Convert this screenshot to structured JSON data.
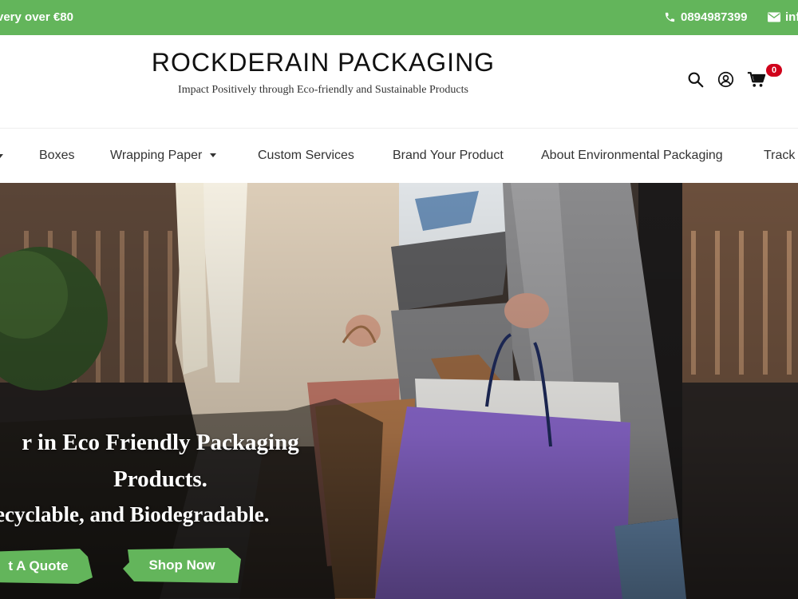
{
  "topbar": {
    "promo": "very over €80",
    "phone": "0894987399",
    "email": "inf"
  },
  "header": {
    "brand_name": "ROCKDERAIN PACKAGING",
    "tagline": "Impact Positively through Eco-friendly and Sustainable Products",
    "cart_count": "0"
  },
  "nav": {
    "items": [
      {
        "label": "Boxes"
      },
      {
        "label": "Wrapping Paper"
      },
      {
        "label": "Custom Services"
      },
      {
        "label": "Brand Your Product"
      },
      {
        "label": "About Environmental Packaging"
      },
      {
        "label": "Track"
      }
    ]
  },
  "hero": {
    "line1": "r in Eco Friendly Packaging",
    "line2": "Products.",
    "line3": "ecyclable, and Biodegradable.",
    "quote_button": "t A Quote",
    "shop_button": "Shop Now"
  },
  "colors": {
    "accent_green": "#63b55b",
    "badge_red": "#d0021b"
  },
  "icons": [
    "phone-icon",
    "mail-icon",
    "search-icon",
    "user-icon",
    "cart-icon",
    "caret-down-icon"
  ]
}
